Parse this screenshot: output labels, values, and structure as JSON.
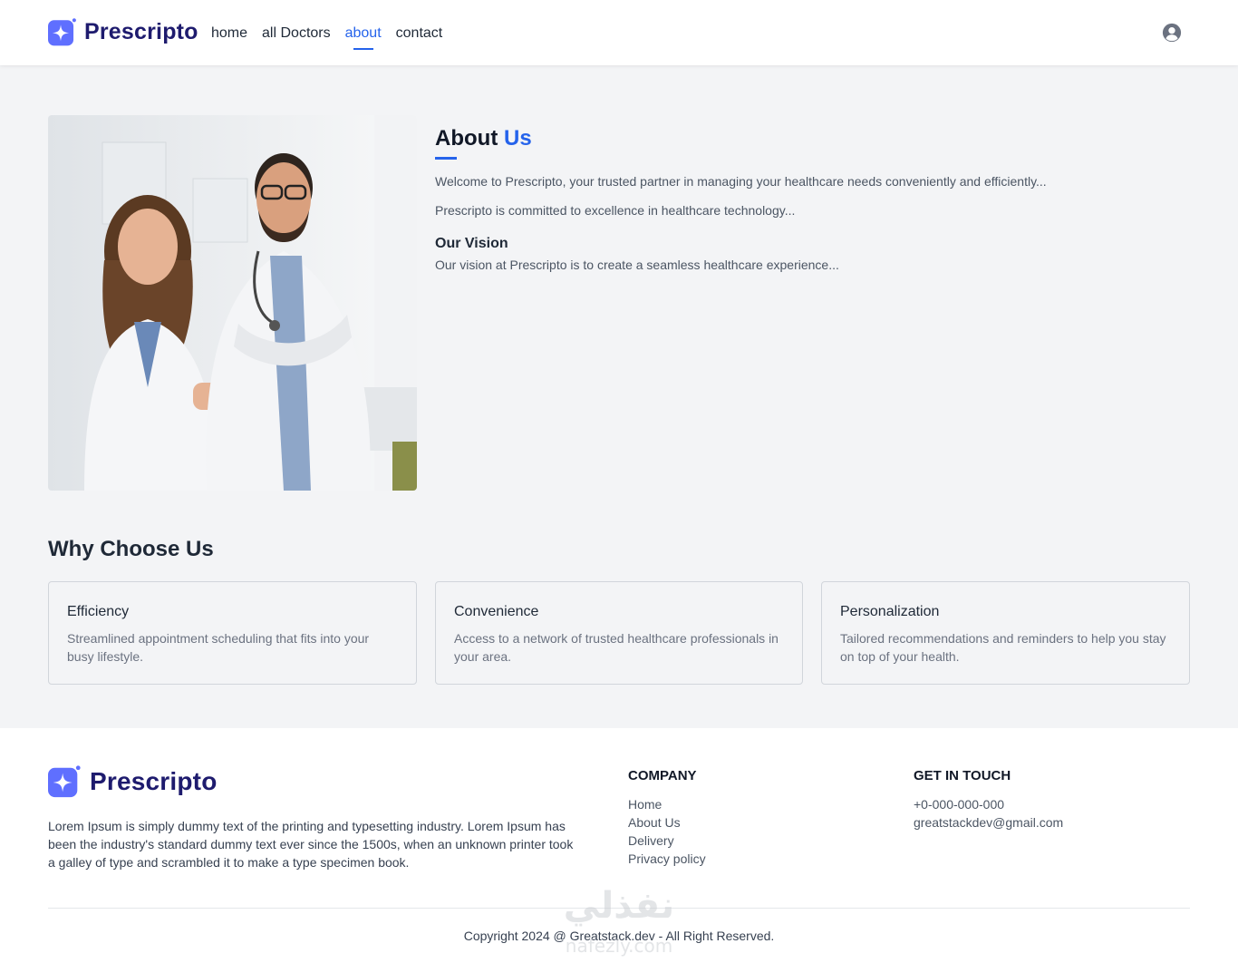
{
  "brand": {
    "name": "Prescripto",
    "color": "#5f6fff"
  },
  "nav": {
    "items": [
      {
        "label": "home"
      },
      {
        "label": "all Doctors"
      },
      {
        "label": "about"
      },
      {
        "label": "contact"
      }
    ],
    "active": "about"
  },
  "header": {
    "profile_icon": "user-circle-icon"
  },
  "about": {
    "title_main": "About",
    "title_accent": "Us",
    "paragraph1": "Welcome to Prescripto, your trusted partner in managing your healthcare needs conveniently and efficiently...",
    "paragraph2": "Prescripto is committed to excellence in healthcare technology...",
    "vision_title": "Our Vision",
    "vision_text": "Our vision at Prescripto is to create a seamless healthcare experience..."
  },
  "why": {
    "title": "Why Choose Us",
    "cards": [
      {
        "title": "Efficiency",
        "text": "Streamlined appointment scheduling that fits into your busy lifestyle."
      },
      {
        "title": "Convenience",
        "text": "Access to a network of trusted healthcare professionals in your area."
      },
      {
        "title": "Personalization",
        "text": "Tailored recommendations and reminders to help you stay on top of your health."
      }
    ]
  },
  "footer": {
    "description": "Lorem Ipsum is simply dummy text of the printing and typesetting industry. Lorem Ipsum has been the industry's standard dummy text ever since the 1500s, when an unknown printer took a galley of type and scrambled it to make a type specimen book.",
    "company_heading": "COMPANY",
    "company_links": [
      "Home",
      "About Us",
      "Delivery",
      "Privacy policy"
    ],
    "contact_heading": "GET IN TOUCH",
    "phone": "+0-000-000-000",
    "email": "greatstackdev@gmail.com",
    "copyright": "Copyright 2024 @ Greatstack.dev - All Right Reserved."
  },
  "watermark": {
    "text_arabic": "نفذلي",
    "text_latin": "nafezly.com"
  }
}
